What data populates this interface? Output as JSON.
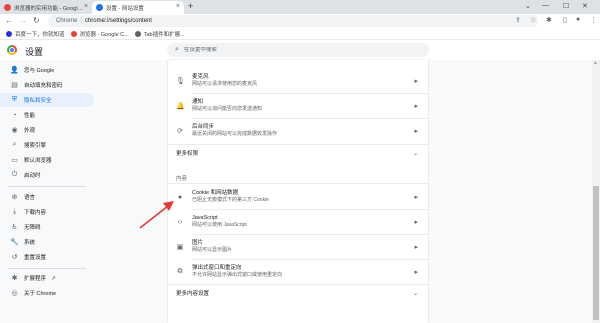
{
  "browser": {
    "tabs": [
      {
        "title": "浏览器的实用功能 - Google Ch...",
        "active": false,
        "favicon_color": "#e8453c"
      },
      {
        "title": "设置 - 网站设置",
        "active": true,
        "favicon_color": "#1a73e8"
      }
    ],
    "new_tab": "+",
    "window_controls": {
      "dropdown": "⌄",
      "minimize": "—",
      "maximize": "☐",
      "close": "✕"
    },
    "nav": {
      "back": "←",
      "forward": "→",
      "reload": "↻"
    },
    "address": {
      "site_label": "Chrome",
      "separator": "|",
      "url": "chrome://settings/content"
    },
    "bookmarks": [
      {
        "label": "百度一下，你就知道",
        "color": "#2932e1"
      },
      {
        "label": "浏览器 - Google C...",
        "color": "#ea4335"
      },
      {
        "label": "Tab插件和扩展...",
        "color": "#5f6368"
      }
    ]
  },
  "settings": {
    "title": "设置",
    "search_placeholder": "在设置中搜索",
    "sidebar": [
      {
        "label": "您与 Google",
        "icon": "person-icon",
        "glyph": "👤",
        "active": false
      },
      {
        "label": "自动填充和密码",
        "icon": "autofill-icon",
        "glyph": "▤",
        "active": false
      },
      {
        "label": "隐私和安全",
        "icon": "shield-icon",
        "glyph": "⛨",
        "active": true
      },
      {
        "label": "性能",
        "icon": "performance-icon",
        "glyph": "◔",
        "active": false
      },
      {
        "label": "外观",
        "icon": "palette-icon",
        "glyph": "◉",
        "active": false
      },
      {
        "label": "搜索引擎",
        "icon": "search-icon",
        "glyph": "⌕",
        "active": false
      },
      {
        "label": "默认浏览器",
        "icon": "browser-icon",
        "glyph": "▭",
        "active": false
      },
      {
        "label": "启动时",
        "icon": "power-icon",
        "glyph": "⏻",
        "active": false
      },
      {
        "label": "语言",
        "icon": "globe-icon",
        "glyph": "⊕",
        "active": false
      },
      {
        "label": "下载内容",
        "icon": "download-icon",
        "glyph": "⤓",
        "active": false
      },
      {
        "label": "无障碍",
        "icon": "accessibility-icon",
        "glyph": "♿",
        "active": false
      },
      {
        "label": "系统",
        "icon": "wrench-icon",
        "glyph": "🔧",
        "active": false
      },
      {
        "label": "重置设置",
        "icon": "reset-icon",
        "glyph": "↺",
        "active": false
      },
      {
        "label": "扩展程序",
        "icon": "puzzle-icon",
        "glyph": "✱",
        "active": false
      },
      {
        "label": "关于 Chrome",
        "icon": "chrome-icon",
        "glyph": "◎",
        "active": false
      }
    ],
    "extension_link_glyph": "↗",
    "content": {
      "rows_top": [
        {
          "title": "麦克风",
          "desc": "网站可以请求使用您的麦克风",
          "icon": "microphone-icon",
          "glyph": "🎙"
        },
        {
          "title": "通知",
          "desc": "网站可以询问能否向您发送通知",
          "icon": "bell-icon",
          "glyph": "🔔"
        },
        {
          "title": "后台同步",
          "desc": "最近关闭的网站可以完成数据收发操作",
          "icon": "sync-icon",
          "glyph": "⟳"
        }
      ],
      "more_permissions": "更多权限",
      "section_content": "内容",
      "rows_content": [
        {
          "title": "Cookie 和网站数据",
          "desc": "已阻止无痕模式下的第三方 Cookie",
          "icon": "cookie-icon",
          "glyph": "●"
        },
        {
          "title": "JavaScript",
          "desc": "网站可以使用 JavaScript",
          "icon": "code-icon",
          "glyph": "‹›"
        },
        {
          "title": "图片",
          "desc": "网站可以显示图片",
          "icon": "image-icon",
          "glyph": "▣"
        },
        {
          "title": "弹出式窗口和重定向",
          "desc": "不允许网站显示弹出式窗口或使用重定向",
          "icon": "popup-icon",
          "glyph": "⧉"
        }
      ],
      "more_content_settings": "更多内容设置",
      "arrow_glyph": "▸",
      "chevron_glyph": "⌄"
    },
    "annotation_color": "#e53935"
  }
}
